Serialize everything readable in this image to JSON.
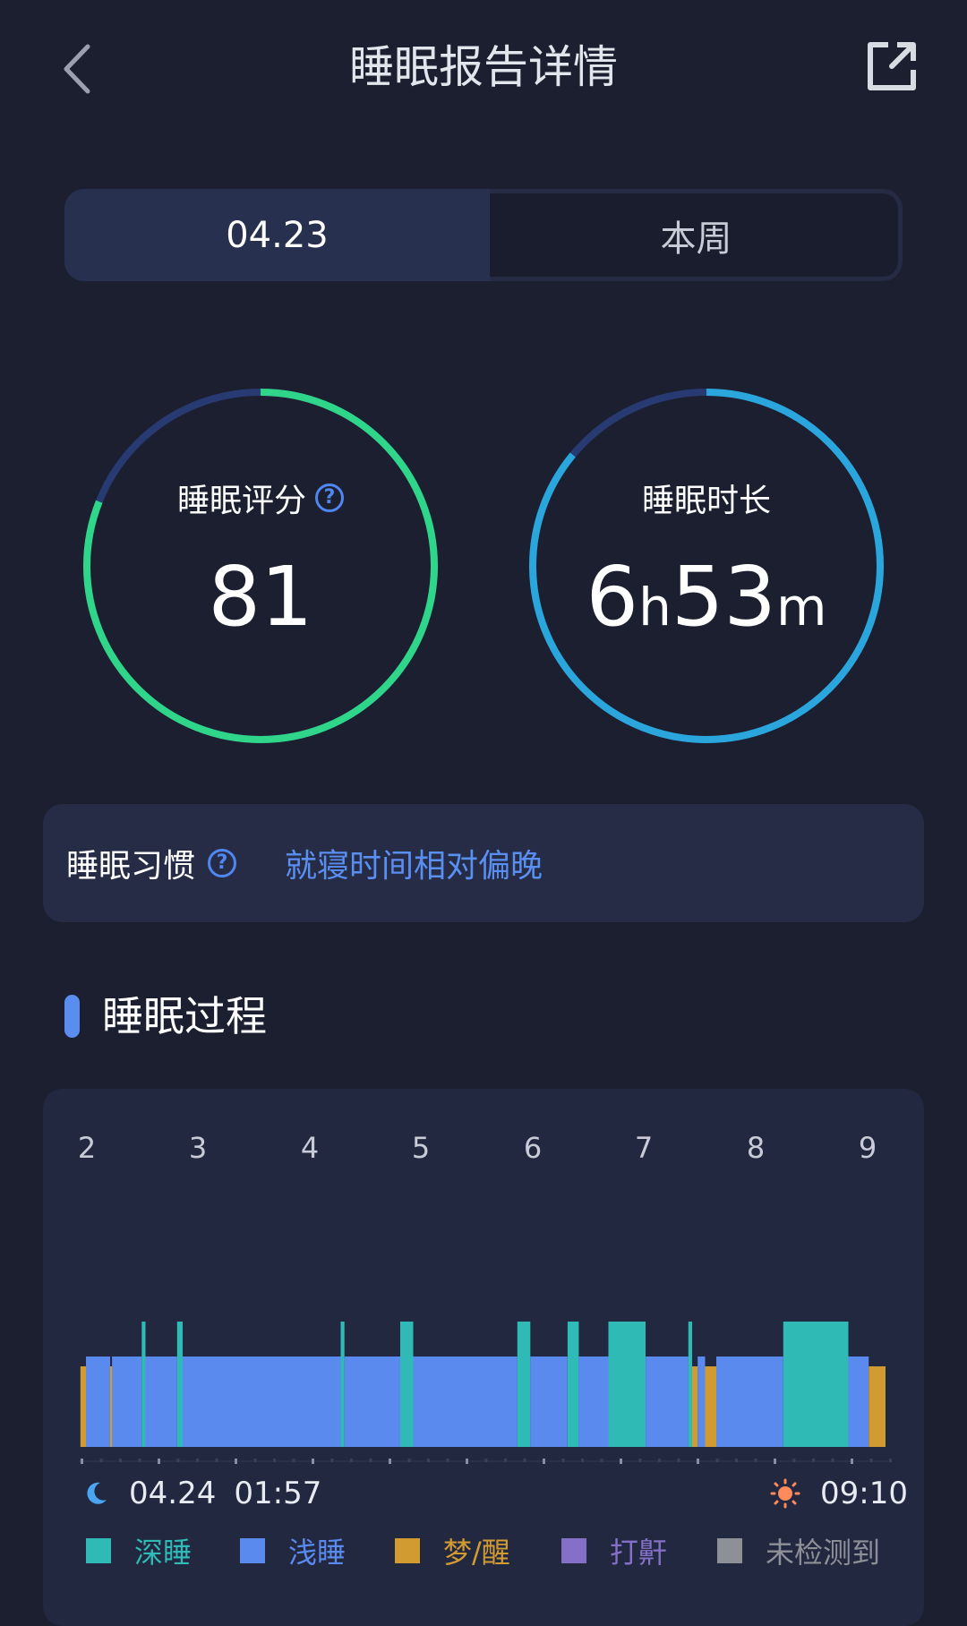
{
  "header": {
    "title": "睡眠报告详情",
    "back_icon": "chevron-left-icon",
    "share_icon": "share-export-icon"
  },
  "tabs": [
    {
      "label": "04.23",
      "active": true
    },
    {
      "label": "本周",
      "active": false
    }
  ],
  "score": {
    "label": "睡眠评分",
    "value": "81",
    "progress": 0.81,
    "color": "#2fd68a"
  },
  "duration": {
    "label": "睡眠时长",
    "hours": "6",
    "hours_unit": "h",
    "minutes": "53",
    "minutes_unit": "m",
    "progress": 0.86,
    "color": "#2aa6dc"
  },
  "habit": {
    "label": "睡眠习惯",
    "value": "就寝时间相对偏晚"
  },
  "section": {
    "title": "睡眠过程"
  },
  "chart_data": {
    "type": "bar",
    "title": "",
    "x_axis_labels": [
      "2",
      "3",
      "4",
      "5",
      "6",
      "7",
      "8",
      "9"
    ],
    "start": {
      "date": "04.24",
      "time": "01:57"
    },
    "end": {
      "time": "09:10"
    },
    "stages": [
      {
        "key": "awake",
        "name": "梦/醒",
        "color": "#d29b32",
        "level": 1
      },
      {
        "key": "light",
        "name": "浅睡",
        "color": "#5a8aee",
        "level": 2
      },
      {
        "key": "deep",
        "name": "深睡",
        "color": "#2fbab5",
        "level": 3
      },
      {
        "key": "snore",
        "name": "打鼾",
        "color": "#8470c6",
        "level": 0
      },
      {
        "key": "none",
        "name": "未检测到",
        "color": "#8e9097",
        "level": 0
      }
    ],
    "segments": [
      {
        "stage": "awake",
        "start": "01:57",
        "end": "02:00"
      },
      {
        "stage": "light",
        "start": "02:00",
        "end": "02:13"
      },
      {
        "stage": "awake",
        "start": "02:13",
        "end": "02:14"
      },
      {
        "stage": "light",
        "start": "02:14",
        "end": "02:30"
      },
      {
        "stage": "deep",
        "start": "02:30",
        "end": "02:32"
      },
      {
        "stage": "light",
        "start": "02:32",
        "end": "02:49"
      },
      {
        "stage": "deep",
        "start": "02:49",
        "end": "02:52"
      },
      {
        "stage": "light",
        "start": "02:52",
        "end": "04:17"
      },
      {
        "stage": "deep",
        "start": "04:17",
        "end": "04:19"
      },
      {
        "stage": "light",
        "start": "04:19",
        "end": "04:49"
      },
      {
        "stage": "deep",
        "start": "04:49",
        "end": "04:56"
      },
      {
        "stage": "light",
        "start": "04:56",
        "end": "05:52"
      },
      {
        "stage": "deep",
        "start": "05:52",
        "end": "05:59"
      },
      {
        "stage": "light",
        "start": "05:59",
        "end": "06:19"
      },
      {
        "stage": "deep",
        "start": "06:19",
        "end": "06:25"
      },
      {
        "stage": "light",
        "start": "06:25",
        "end": "06:41"
      },
      {
        "stage": "deep",
        "start": "06:41",
        "end": "07:01"
      },
      {
        "stage": "light",
        "start": "07:01",
        "end": "07:24"
      },
      {
        "stage": "deep",
        "start": "07:24",
        "end": "07:26"
      },
      {
        "stage": "awake",
        "start": "07:26",
        "end": "07:29"
      },
      {
        "stage": "light",
        "start": "07:29",
        "end": "07:33"
      },
      {
        "stage": "awake",
        "start": "07:33",
        "end": "07:39"
      },
      {
        "stage": "light",
        "start": "07:39",
        "end": "08:15"
      },
      {
        "stage": "deep",
        "start": "08:15",
        "end": "08:50"
      },
      {
        "stage": "light",
        "start": "08:50",
        "end": "09:01"
      },
      {
        "stage": "awake",
        "start": "09:01",
        "end": "09:10"
      }
    ]
  },
  "colors": {
    "background": "#1b1f30",
    "card": "#262c45",
    "accent_blue": "#5a8ff2"
  }
}
